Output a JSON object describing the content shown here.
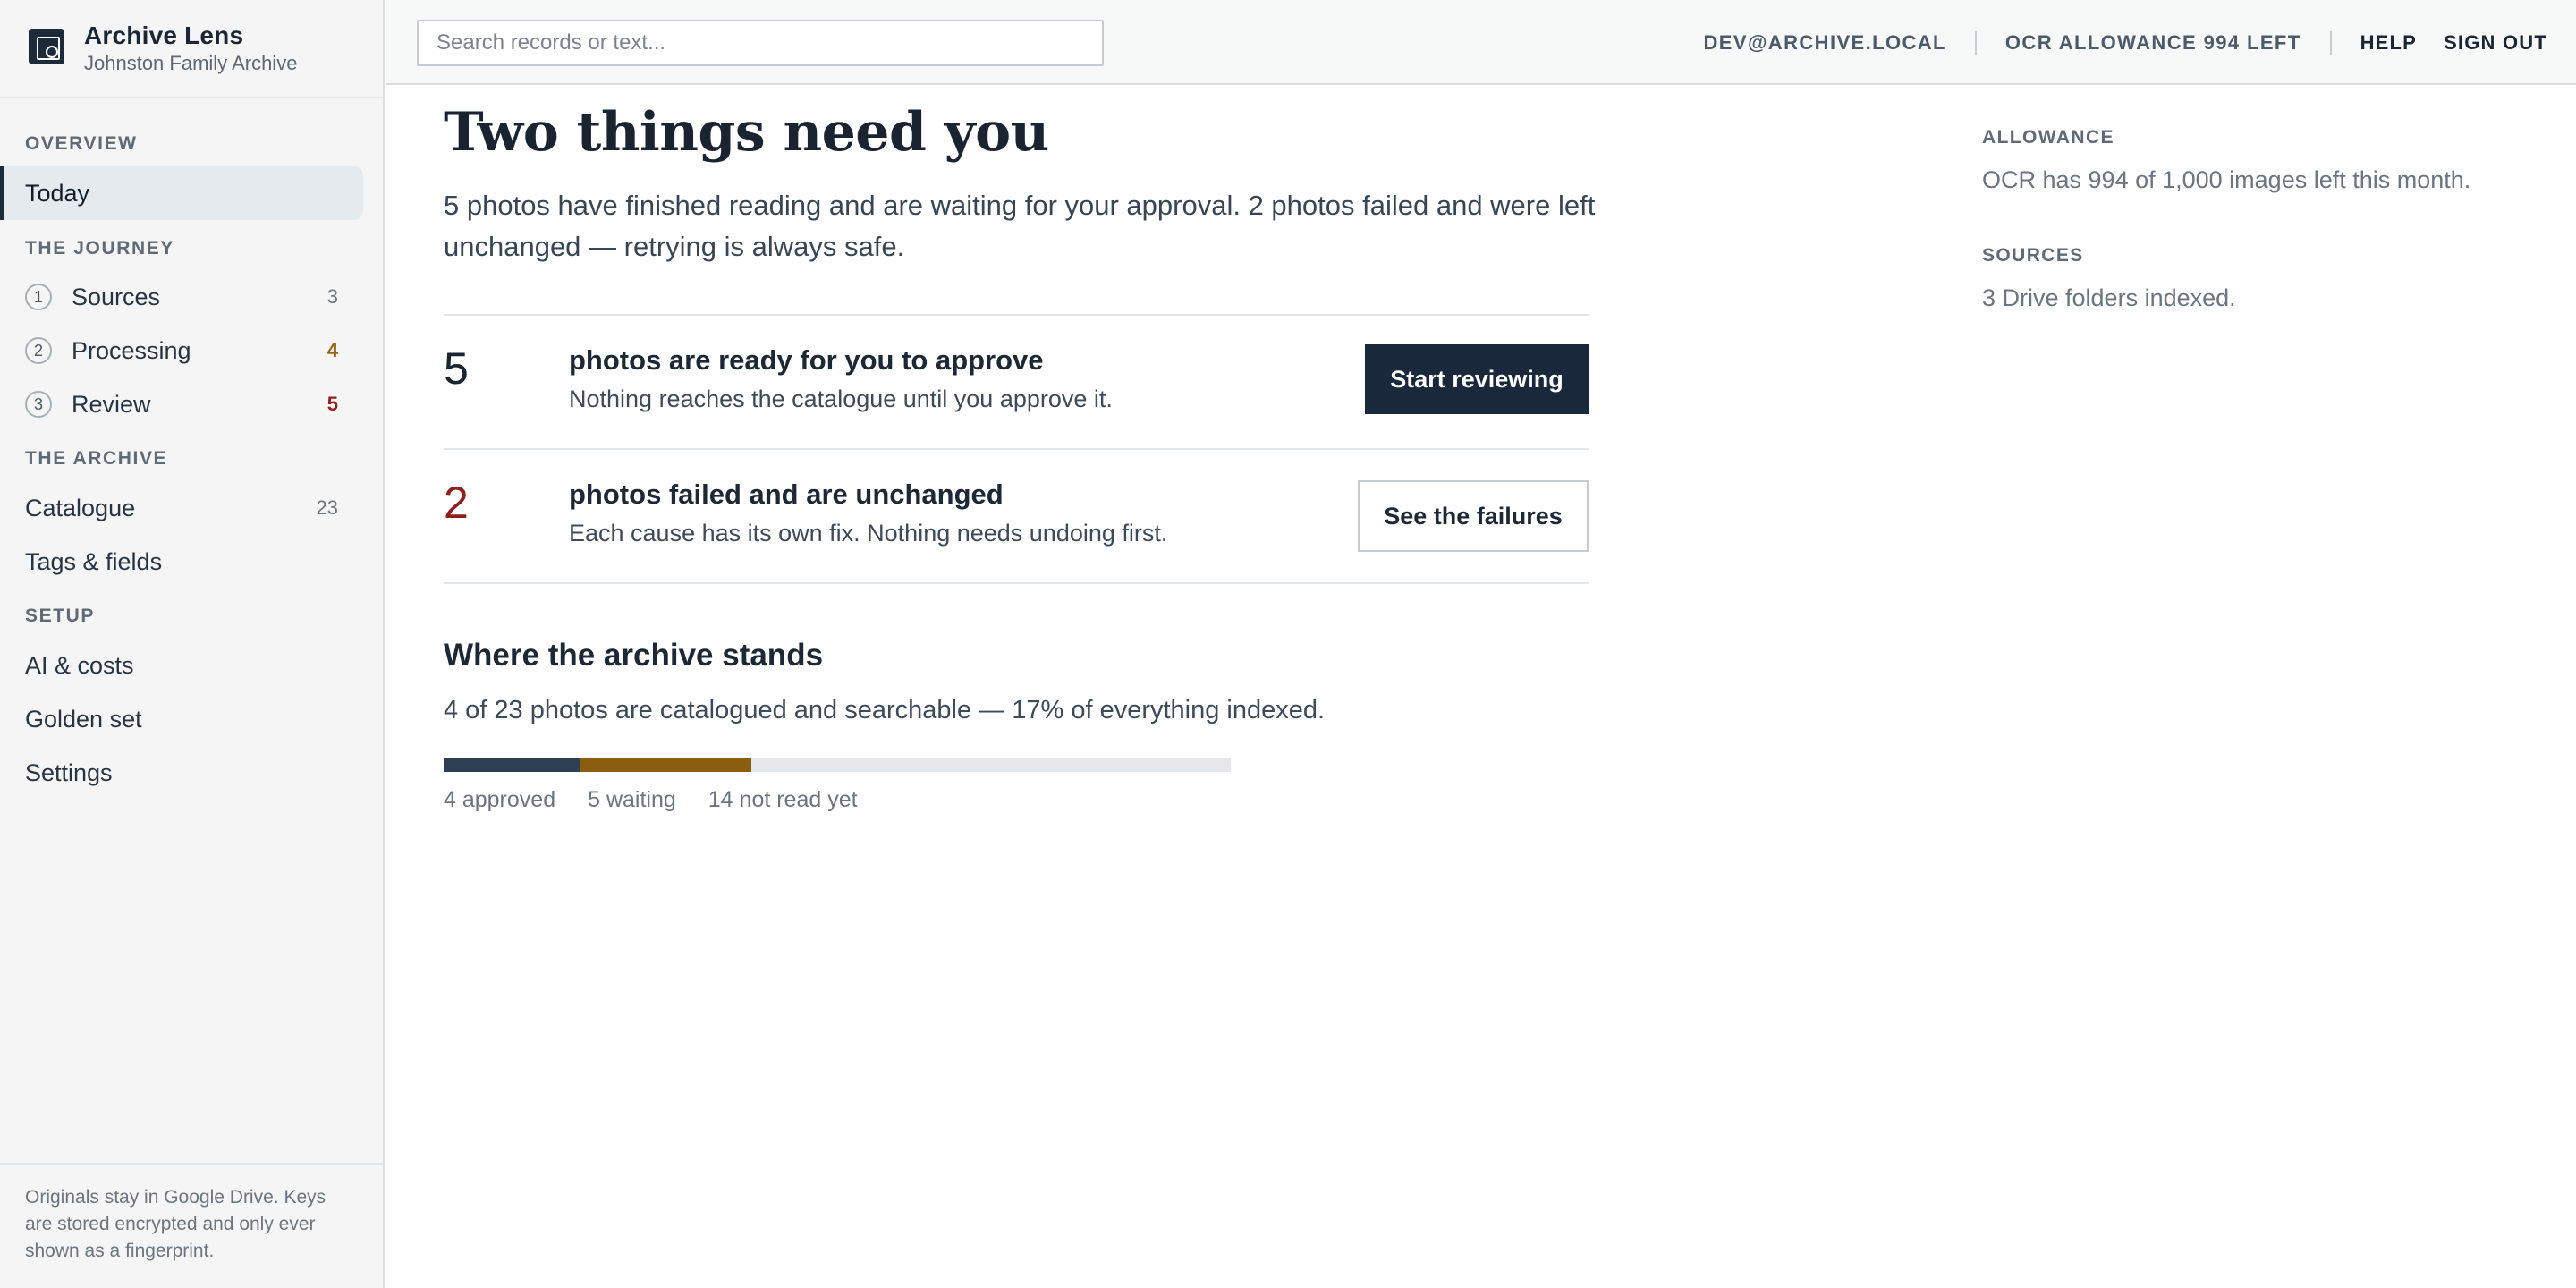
{
  "app": {
    "name": "Archive Lens",
    "archive": "Johnston Family Archive"
  },
  "sidebar": {
    "overview_label": "OVERVIEW",
    "today": "Today",
    "journey_label": "THE JOURNEY",
    "journey": [
      {
        "step": "1",
        "label": "Sources",
        "count": "3"
      },
      {
        "step": "2",
        "label": "Processing",
        "count": "4"
      },
      {
        "step": "3",
        "label": "Review",
        "count": "5"
      }
    ],
    "archive_label": "THE ARCHIVE",
    "catalogue": {
      "label": "Catalogue",
      "count": "23"
    },
    "tags": "Tags & fields",
    "setup_label": "SETUP",
    "ai_costs": "AI & costs",
    "golden_set": "Golden set",
    "settings": "Settings",
    "footer": "Originals stay in Google Drive. Keys are stored encrypted and only ever shown as a fingerprint."
  },
  "topbar": {
    "search_placeholder": "Search records or text...",
    "user": "DEV@ARCHIVE.LOCAL",
    "allowance": "OCR ALLOWANCE 994 LEFT",
    "help": "HELP",
    "sign_out": "SIGN OUT"
  },
  "main": {
    "headline": "Two things need you",
    "lead": "5 photos have finished reading and are waiting for your approval. 2 photos failed and were left unchanged — retrying is always safe.",
    "ready": {
      "count": "5",
      "title": "photos are ready for you to approve",
      "desc": "Nothing reaches the catalogue until you approve it.",
      "button": "Start reviewing"
    },
    "failed": {
      "count": "2",
      "title": "photos failed and are unchanged",
      "desc": "Each cause has its own fix. Nothing needs undoing first.",
      "button": "See the failures"
    },
    "status": {
      "title": "Where the archive stands",
      "text": "4 of 23 photos are catalogued and searchable — 17% of everything indexed.",
      "total": 23,
      "segments": [
        {
          "label": "4 approved",
          "value": 4,
          "color": "#2f3f53"
        },
        {
          "label": "5 waiting",
          "value": 5,
          "color": "#8b5d0e"
        },
        {
          "label": "14 not read yet",
          "value": 14,
          "color": "#e6e7e8"
        }
      ]
    }
  },
  "rail": {
    "allowance_label": "ALLOWANCE",
    "allowance_text": "OCR has 994 of 1,000 images left this month.",
    "sources_label": "SOURCES",
    "sources_text": "3 Drive folders indexed."
  }
}
